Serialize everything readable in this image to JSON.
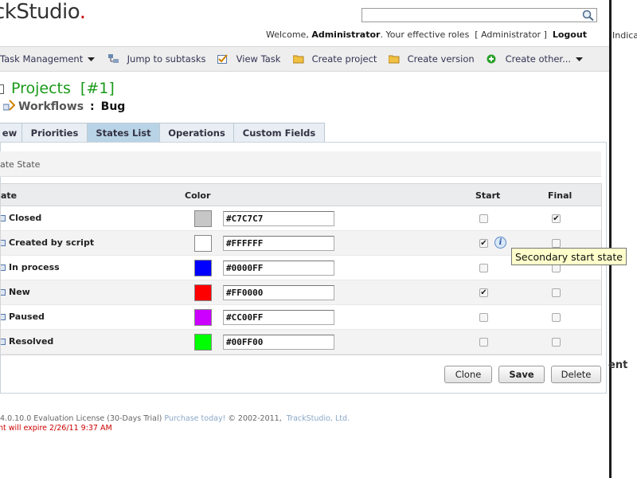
{
  "header": {
    "logo_text": "ckStudio",
    "logo_dot": ".",
    "search": {
      "value": "",
      "placeholder": ""
    },
    "welcome_prefix": "Welcome,",
    "user": "Administrator",
    "roles_text": ". Your effective roles",
    "role": "[ Administrator ]",
    "logout": "Logout",
    "right_fragment": "Indica",
    "right_fragment2": "ent"
  },
  "toolbar": {
    "items": [
      {
        "label": "Task Management"
      },
      {
        "label": "Jump to subtasks"
      },
      {
        "label": "View Task"
      },
      {
        "label": "Create project"
      },
      {
        "label": "Create version"
      },
      {
        "label": "Create other..."
      }
    ]
  },
  "page": {
    "title": "Projects",
    "title_id": "[#1]",
    "workflows_label": "Workflows",
    "separator": ":",
    "workflow_name": "Bug"
  },
  "tabs": [
    {
      "label": "ew"
    },
    {
      "label": "Priorities"
    },
    {
      "label": "States List",
      "active": true
    },
    {
      "label": "Operations"
    },
    {
      "label": "Custom Fields"
    }
  ],
  "sub_header": "ate State",
  "table": {
    "headers": {
      "state": "ate",
      "color": "Color",
      "start": "Start",
      "final": "Final"
    },
    "rows": [
      {
        "name": "Closed",
        "color": "#C7C7C7",
        "start": false,
        "final": true
      },
      {
        "name": "Created by script",
        "color": "#FFFFFF",
        "start": true,
        "final": false,
        "info": true
      },
      {
        "name": "In process",
        "color": "#0000FF",
        "start": false,
        "final": false
      },
      {
        "name": "New",
        "color": "#FF0000",
        "start": true,
        "final": false
      },
      {
        "name": "Paused",
        "color": "#CC00FF",
        "start": false,
        "final": false
      },
      {
        "name": "Resolved",
        "color": "#00FF00",
        "start": false,
        "final": false
      }
    ]
  },
  "tooltip": "Secondary start state",
  "buttons": {
    "clone": "Clone",
    "save": "Save",
    "delete": "Delete"
  },
  "footer": {
    "version": "4.0.10.0 Evaluation License (30-Days Trial)",
    "purchase": "Purchase today!",
    "copyright": "© 2002-2011,",
    "company": "TrackStudio, Ltd.",
    "expire": "nt will expire 2/26/11 9:37 AM"
  },
  "colors": {
    "accent": "#1a9a1a",
    "tab_active": "#b9d3e6",
    "logo_dot": "#cc0000"
  }
}
